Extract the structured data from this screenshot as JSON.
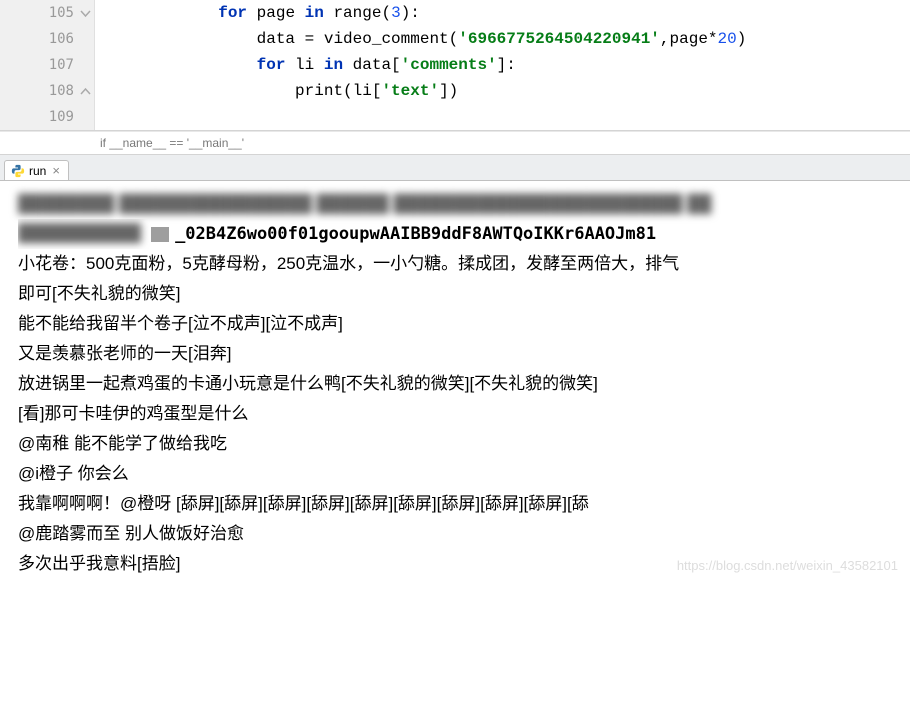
{
  "editor": {
    "lines": [
      {
        "num": "105",
        "indent": "            ",
        "tokens": [
          {
            "t": "kw",
            "v": "for"
          },
          {
            "t": "plain",
            "v": " page "
          },
          {
            "t": "kw",
            "v": "in"
          },
          {
            "t": "plain",
            "v": " "
          },
          {
            "t": "fn",
            "v": "range"
          },
          {
            "t": "plain",
            "v": "("
          },
          {
            "t": "num",
            "v": "3"
          },
          {
            "t": "plain",
            "v": "):"
          }
        ],
        "fold": "start"
      },
      {
        "num": "106",
        "indent": "                ",
        "tokens": [
          {
            "t": "plain",
            "v": "data = video_comment("
          },
          {
            "t": "str",
            "v": "'6966775264504220941'"
          },
          {
            "t": "plain",
            "v": ",page*"
          },
          {
            "t": "num",
            "v": "20"
          },
          {
            "t": "plain",
            "v": ")"
          }
        ]
      },
      {
        "num": "107",
        "indent": "                ",
        "tokens": [
          {
            "t": "kw",
            "v": "for"
          },
          {
            "t": "plain",
            "v": " li "
          },
          {
            "t": "kw",
            "v": "in"
          },
          {
            "t": "plain",
            "v": " data["
          },
          {
            "t": "str",
            "v": "'comments'"
          },
          {
            "t": "plain",
            "v": "]:"
          }
        ]
      },
      {
        "num": "108",
        "indent": "                    ",
        "tokens": [
          {
            "t": "fn",
            "v": "print"
          },
          {
            "t": "plain",
            "v": "(li["
          },
          {
            "t": "str",
            "v": "'text'"
          },
          {
            "t": "plain",
            "v": "])"
          }
        ],
        "fold": "end"
      },
      {
        "num": "109",
        "indent": "",
        "tokens": []
      }
    ]
  },
  "breadcrumb": {
    "text": "if __name__ == '__main__'"
  },
  "tool_tab": {
    "label": "run"
  },
  "console": {
    "lines": [
      {
        "blurred": true,
        "text": "████████ ████████████████ ██████ ████████████████████████ ██"
      },
      {
        "mono": true,
        "text": "_02B4Z6wo00f01gooupwAAIBB9ddF8AWTQoIKKr6AAOJm81"
      },
      {
        "text": "小花卷：500克面粉，5克酵母粉，250克温水，一小勺糖。揉成团，发酵至两倍大，排气"
      },
      {
        "text": "即可[不失礼貌的微笑]"
      },
      {
        "text": "能不能给我留半个卷子[泣不成声][泣不成声]"
      },
      {
        "text": "又是羡慕张老师的一天[泪奔]"
      },
      {
        "text": "放进锅里一起煮鸡蛋的卡通小玩意是什么鸭[不失礼貌的微笑][不失礼貌的微笑]"
      },
      {
        "text": "[看]那可卡哇伊的鸡蛋型是什么"
      },
      {
        "text": "@南稚  能不能学了做给我吃"
      },
      {
        "text": "@i橙子  你会么"
      },
      {
        "text": "我靠啊啊啊！@橙呀  [舔屏][舔屏][舔屏][舔屏][舔屏][舔屏][舔屏][舔屏][舔屏][舔"
      },
      {
        "text": "@鹿踏雾而至  别人做饭好治愈"
      },
      {
        "text": "多次出乎我意料[捂脸]"
      }
    ]
  },
  "watermark": {
    "text": "https://blog.csdn.net/weixin_43582101"
  }
}
